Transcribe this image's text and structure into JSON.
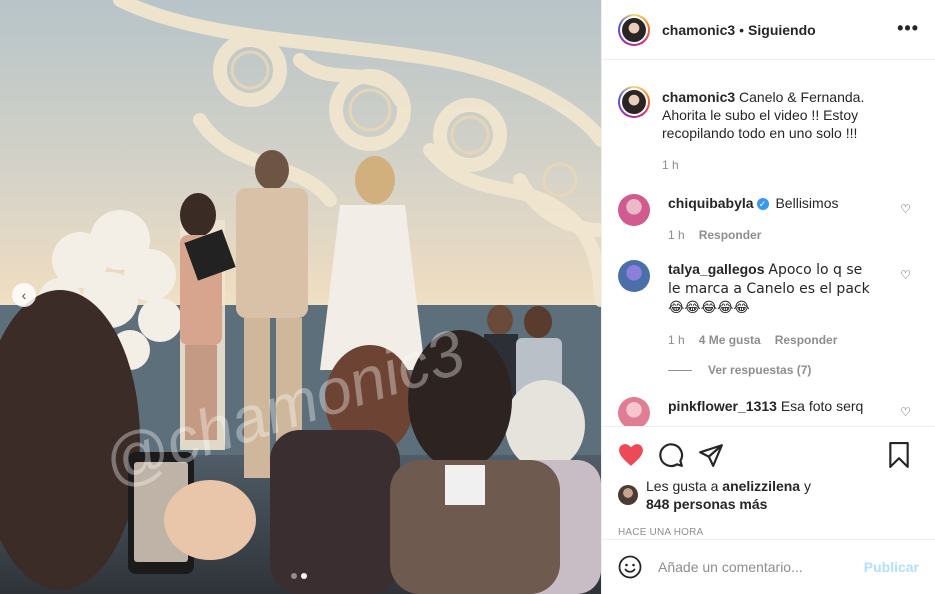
{
  "post": {
    "username": "chamonic3",
    "follow_label": "Siguiendo",
    "more_label": "•••",
    "caption": "Canelo & Fernanda. Ahorita le subo el video !! Estoy recopilando todo en uno solo !!!",
    "caption_time": "1 h",
    "watermark": "@chamonic3",
    "carousel_prev": "‹"
  },
  "comments": [
    {
      "username": "chiquibabyla",
      "verified": true,
      "text": "Bellisimos",
      "time": "1 h",
      "likes": "",
      "reply_label": "Responder"
    },
    {
      "username": "talya_gallegos",
      "verified": false,
      "text": "Apoco lo q se le marca a Canelo es el pack😂😂😂😂😂",
      "time": "1 h",
      "likes": "4 Me gusta",
      "reply_label": "Responder",
      "view_replies": "Ver respuestas (7)"
    },
    {
      "username": "pinkflower_1313",
      "verified": false,
      "text": "Esa foto serq",
      "time": "",
      "likes": "",
      "reply_label": ""
    }
  ],
  "likes": {
    "prefix": "Les gusta a",
    "user": "anelizzilena",
    "conjunction": "y",
    "others": "848 personas más"
  },
  "timestamp": "HACE UNA HORA",
  "add_comment": {
    "placeholder": "Añade un comentario...",
    "publish_label": "Publicar"
  },
  "colors": {
    "like_red": "#ed4956",
    "verified_blue": "#3897f0",
    "publish_disabled": "#b2dffc"
  },
  "icons": [
    "heart-icon",
    "comment-icon",
    "share-icon",
    "bookmark-icon",
    "emoji-icon",
    "more-icon"
  ]
}
